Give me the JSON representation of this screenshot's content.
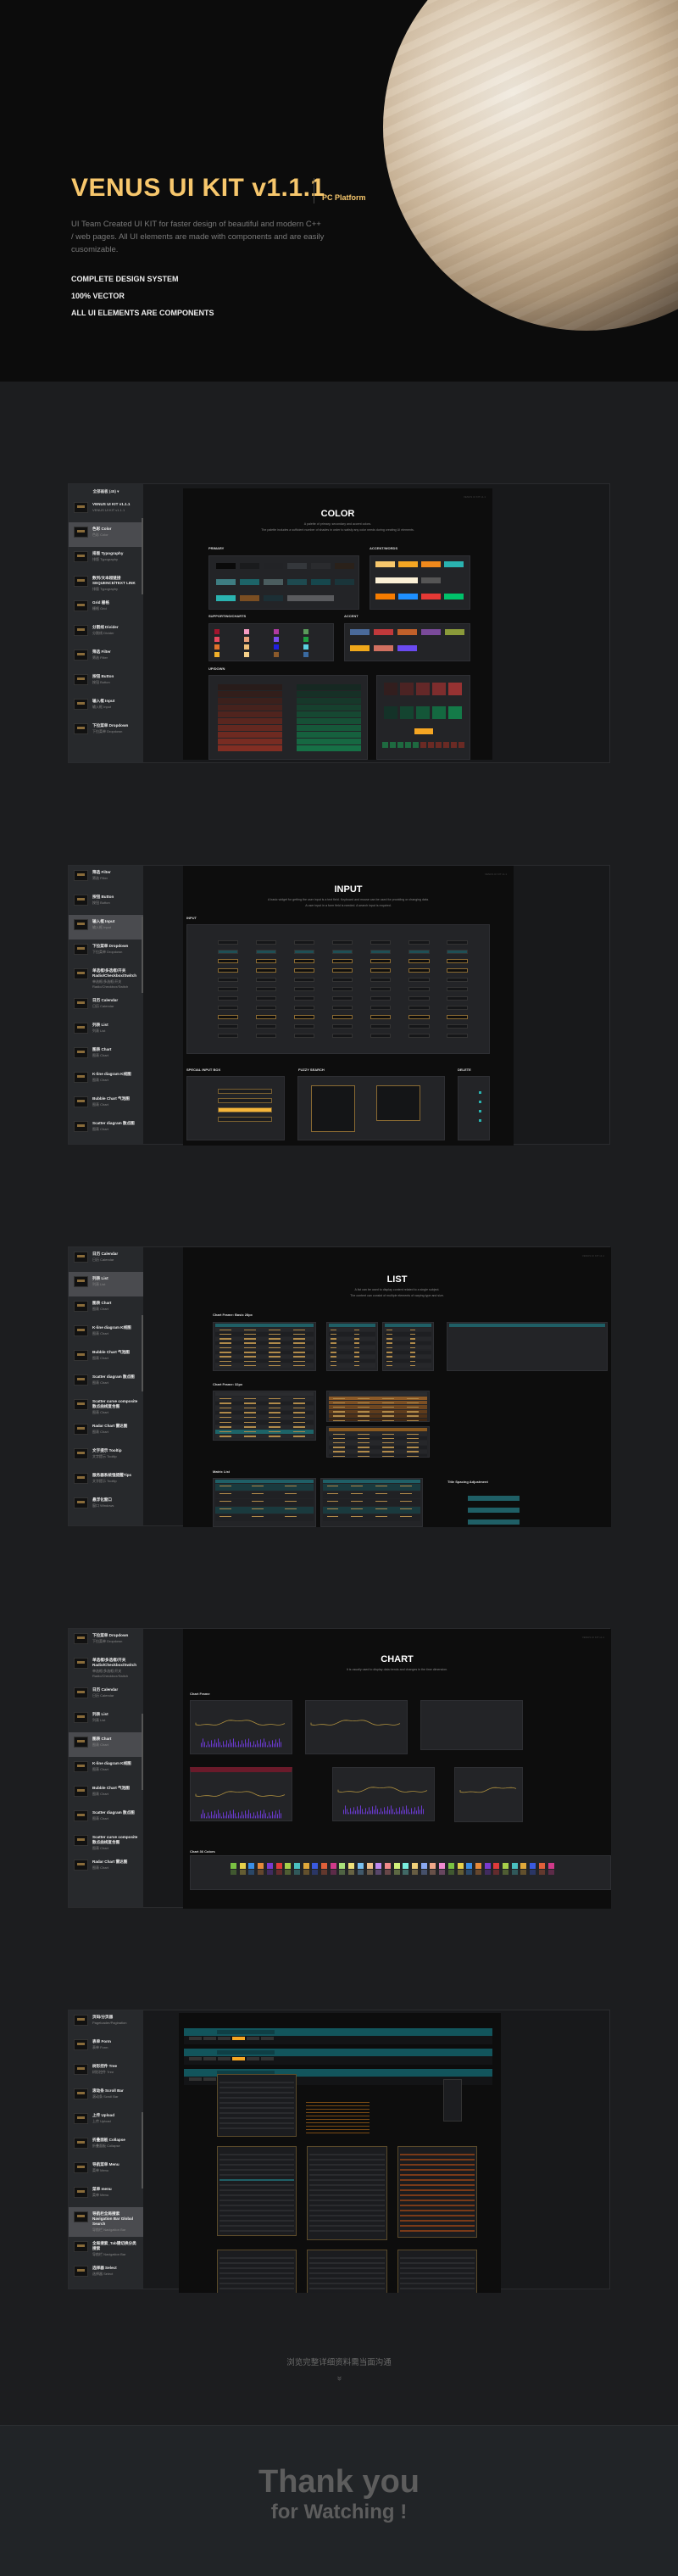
{
  "hero": {
    "title": "VENUS UI KIT v1.1.1",
    "platform": "PC Platform",
    "description": "UI Team Created UI KIT for faster design of beautiful and modern C++ / web pages. All UI elements are made with components and are easily cusomizable.",
    "bullets": [
      "COMPLETE DESIGN SYSTEM",
      "100% VECTOR",
      "ALL UI ELEMENTS ARE COMPONENTS"
    ]
  },
  "colors": {
    "gold": "#f7c76c",
    "teal": "#1f5f66",
    "teal_bright": "#2ab3b0",
    "orange": "#f5a623",
    "red": "#c0392b",
    "green": "#1e8a4f"
  },
  "watermark": "VENUS UI KIT v1.1",
  "showcases": [
    {
      "sidebar": {
        "header": "全部画板 (45) ▾",
        "items": [
          {
            "title": "VENUS UI KIT v1.1.1",
            "sub": "VENUS UI KIT v1.1.1"
          },
          {
            "title": "色彩 Color",
            "sub": "色彩 Color",
            "selected": true
          },
          {
            "title": "排版 Typography",
            "sub": "排版 Typography"
          },
          {
            "title": "数列/文本超链接 SEQUENCE/TEXT LINK",
            "sub": "排版 Typography"
          },
          {
            "title": "Grid 栅格",
            "sub": "栅格 Grid"
          },
          {
            "title": "分割线 Divider",
            "sub": "分割线 Divider"
          },
          {
            "title": "筛选 Filter",
            "sub": "筛选 Filter"
          },
          {
            "title": "按钮 Button",
            "sub": "按钮 Button"
          },
          {
            "title": "输入框 Input",
            "sub": "输入框 Input"
          },
          {
            "title": "下拉菜单 Dropdown",
            "sub": "下拉菜单 Dropdown"
          }
        ]
      },
      "panel": {
        "title": "COLOR",
        "subtitle": [
          "A palette of primary, secondary and accent colors.",
          "The palette includes a sufficient number of shades in order to satisfy any color needs during creating UI elements."
        ],
        "sections": [
          "PRIMARY",
          "ACCENT/WORDS",
          "SUPPORTING/CHARTS",
          "ACCENT",
          "UP/DOWN"
        ]
      }
    },
    {
      "sidebar": {
        "items": [
          {
            "title": "筛选 Filter",
            "sub": "筛选 Filter"
          },
          {
            "title": "按钮 Button",
            "sub": "按钮 Button"
          },
          {
            "title": "输入框 Input",
            "sub": "输入框 Input",
            "selected": true
          },
          {
            "title": "下拉菜单 Dropdown",
            "sub": "下拉菜单 Dropdown"
          },
          {
            "title": "单选框/多选框/开关 Radio/Checkbox/Switch",
            "sub": "单选框/多选框/开关 Radio/Checkbox/Switch"
          },
          {
            "title": "日历 Calendar",
            "sub": "日历 Calendar"
          },
          {
            "title": "列表 List",
            "sub": "列表 List"
          },
          {
            "title": "图表 Chart",
            "sub": "图表 Chart"
          },
          {
            "title": "K-line diagram K线图",
            "sub": "图表 Chart"
          },
          {
            "title": "Bubble Chart 气泡图",
            "sub": "图表 Chart"
          },
          {
            "title": "Scatter diagram 散点图",
            "sub": "图表 Chart"
          }
        ]
      },
      "panel": {
        "title": "INPUT",
        "subtitle": [
          "A basic widget for getting the user input is a text field. Keyboard and mouse can be used for providing or changing data.",
          "A user input in a form field is needed. A search input is required."
        ],
        "sections": [
          "INPUT",
          "SPECIAL INPUT BOX",
          "FUZZY SEARCH",
          "DELETE"
        ]
      }
    },
    {
      "sidebar": {
        "items": [
          {
            "title": "日历 Calendar",
            "sub": "日历 Calendar"
          },
          {
            "title": "列表 List",
            "sub": "列表 List",
            "selected": true
          },
          {
            "title": "图表 Chart",
            "sub": "图表 Chart"
          },
          {
            "title": "K-line diagram K线图",
            "sub": "图表 Chart"
          },
          {
            "title": "Bubble Chart 气泡图",
            "sub": "图表 Chart"
          },
          {
            "title": "Scatter diagram 散点图",
            "sub": "图表 Chart"
          },
          {
            "title": "Scatter curve composite 散点曲线复合图",
            "sub": "图表 Chart"
          },
          {
            "title": "Radar Chart 雷达图",
            "sub": "图表 Chart"
          },
          {
            "title": "文字提示 Tooltip",
            "sub": "文字提示 Tooltip"
          },
          {
            "title": "服务器系统强提醒Tips",
            "sub": "文字提示 Tooltip"
          },
          {
            "title": "悬浮化窗口",
            "sub": "窗口 Windows"
          }
        ]
      },
      "panel": {
        "title": "LIST",
        "subtitle": [
          "A list can be used to display content related to a single subject.",
          "The content can consist of multiple elements of varying type and size."
        ],
        "sections": [
          "Chart Frame: Basic 28px",
          "Chart Frame: 32px",
          "Matrix List",
          "Title Spacing Adjustment"
        ]
      }
    },
    {
      "sidebar": {
        "items": [
          {
            "title": "下拉菜单 Dropdown",
            "sub": "下拉菜单 Dropdown"
          },
          {
            "title": "单选框/多选框/开关 Radio/Checkbox/Switch",
            "sub": "单选框/多选框/开关 Radio/Checkbox/Switch"
          },
          {
            "title": "日历 Calendar",
            "sub": "日历 Calendar"
          },
          {
            "title": "列表 List",
            "sub": "列表 List"
          },
          {
            "title": "图表 Chart",
            "sub": "图表 Chart",
            "selected": true
          },
          {
            "title": "K-line diagram K线图",
            "sub": "图表 Chart"
          },
          {
            "title": "Bubble Chart 气泡图",
            "sub": "图表 Chart"
          },
          {
            "title": "Scatter diagram 散点图",
            "sub": "图表 Chart"
          },
          {
            "title": "Scatter curve composite 散点曲线复合图",
            "sub": "图表 Chart"
          },
          {
            "title": "Radar Chart 雷达图",
            "sub": "图表 Chart"
          }
        ]
      },
      "panel": {
        "title": "CHART",
        "subtitle": [
          "It is usually used to display data trends and changes in the time dimension."
        ],
        "sections": [
          "Chart Frame",
          "Chart 36 Colors"
        ]
      }
    },
    {
      "sidebar": {
        "items": [
          {
            "title": "页码/分页器",
            "sub": "Pageloader/Pagination"
          },
          {
            "title": "表单 Form",
            "sub": "表单 Form"
          },
          {
            "title": "树形控件 Tree",
            "sub": "树形控件 Tree"
          },
          {
            "title": "滚动条 Scroll Bar",
            "sub": "滚动条 Scroll Bar"
          },
          {
            "title": "上传 Upload",
            "sub": "上传 Upload"
          },
          {
            "title": "折叠面板 Collapse",
            "sub": "折叠面板 Collapse"
          },
          {
            "title": "导航菜单 Menu",
            "sub": "菜单 Menu"
          },
          {
            "title": "菜单 menu",
            "sub": "菜单 Menu"
          },
          {
            "title": "导航栏全局搜索 Navigation Bar Global Search",
            "sub": "导航栏 Navigation Bar",
            "selected": true
          },
          {
            "title": "全局搜索_Tab键切换分类搜索",
            "sub": "导航栏 Navigation Bar"
          },
          {
            "title": "选择器 Select",
            "sub": "选择器 Select"
          }
        ]
      },
      "panel": {}
    }
  ],
  "footer": {
    "note": "浏览完整详细资料需当面沟通",
    "chevron": "»"
  },
  "thanks": {
    "line1": "Thank you",
    "line2": "for Watching !"
  }
}
